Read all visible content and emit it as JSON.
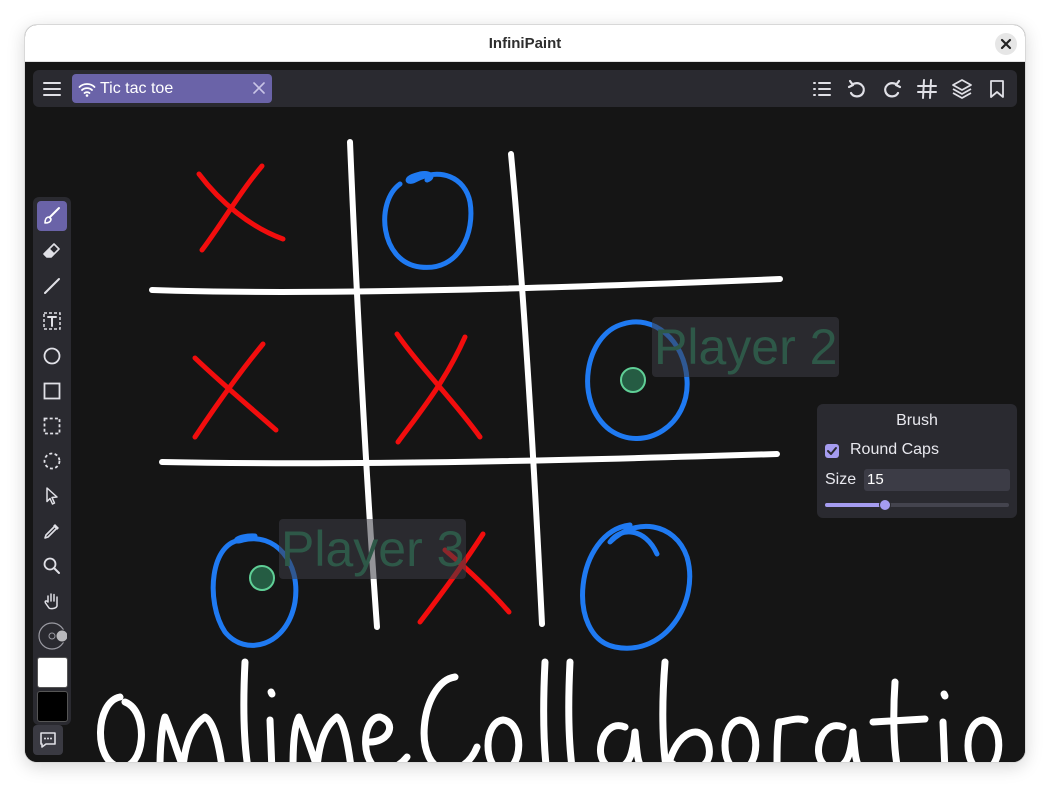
{
  "window": {
    "title": "InfiniPaint"
  },
  "toolbar": {
    "tab": {
      "label": "Tic tac toe"
    },
    "right_icons": [
      "list-icon",
      "undo-icon",
      "redo-icon",
      "grid-icon",
      "layers-icon",
      "bookmark-icon"
    ]
  },
  "tools": [
    "brush-icon",
    "eraser-icon",
    "line-icon",
    "text-icon",
    "circle-icon",
    "rectangle-icon",
    "rect-select-icon",
    "lasso-icon",
    "pointer-icon",
    "eyedropper-icon",
    "zoom-icon",
    "hand-icon"
  ],
  "colors": {
    "accent": "#6a63a8",
    "primary": "#ffffff",
    "secondary": "#000000",
    "stroke_red": "#f20d0d",
    "stroke_blue": "#1f7af2"
  },
  "brush_panel": {
    "title": "Brush",
    "round_caps_label": "Round Caps",
    "round_caps_checked": true,
    "size_label": "Size",
    "size_value": "15",
    "size_slider_fraction": 0.32
  },
  "cursors": [
    {
      "name": "Player 2"
    },
    {
      "name": "Player 3"
    }
  ],
  "canvas": {
    "handwriting": "online collaboration"
  }
}
